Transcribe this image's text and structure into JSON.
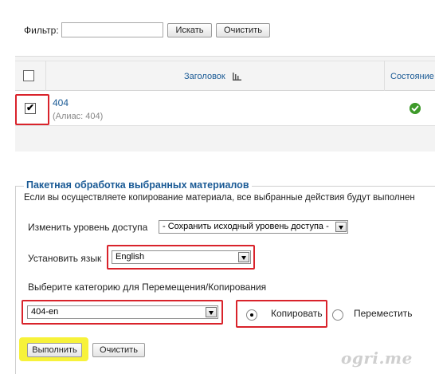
{
  "filter": {
    "label": "Фильтр:",
    "value": "",
    "search_button": "Искать",
    "clear_button": "Очистить"
  },
  "table": {
    "columns": {
      "title": "Заголовок",
      "state": "Состояние"
    },
    "rows": [
      {
        "title": "404",
        "alias": "(Алиас: 404)",
        "checked": true,
        "state": "published"
      }
    ]
  },
  "batch": {
    "legend": "Пакетная обработка выбранных материалов",
    "description": "Если вы осуществляете копирование материала, все выбранные действия будут выполнен",
    "access_label": "Изменить уровень доступа",
    "access_value": "- Сохранить исходный уровень доступа -",
    "language_label": "Установить язык",
    "language_value": "English",
    "category_label": "Выберите категорию для Перемещения/Копирования",
    "category_value": "404-en",
    "copy_label": "Копировать",
    "move_label": "Переместить",
    "selected_action": "copy",
    "run_button": "Выполнить",
    "clear_button": "Очистить"
  },
  "watermark": "ogri.me",
  "colors": {
    "highlight_red": "#d9232b",
    "highlight_yellow": "#f7f23a",
    "link_blue": "#1a5a95",
    "status_green": "#3e9a2a"
  }
}
